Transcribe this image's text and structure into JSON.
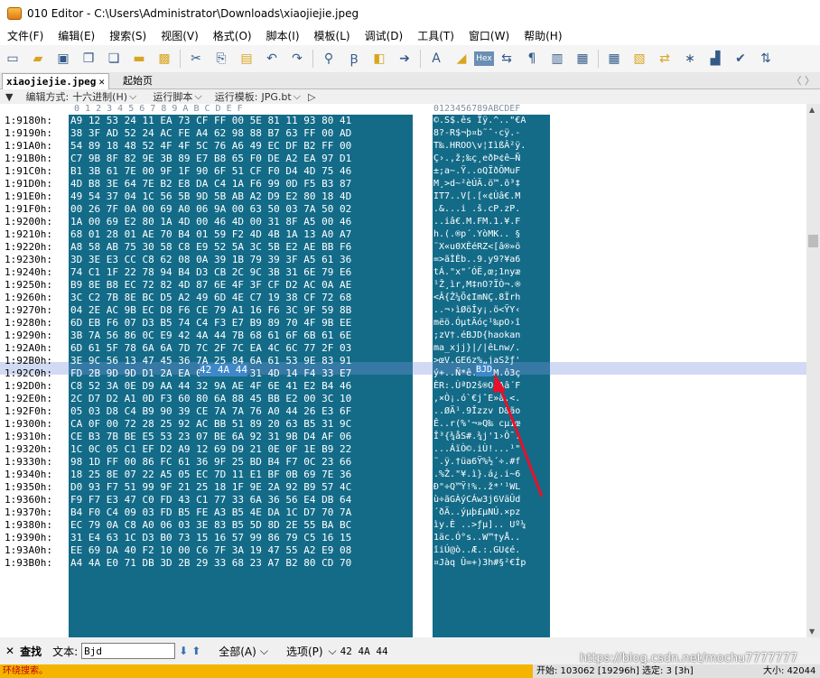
{
  "window": {
    "title": "010 Editor - C:\\Users\\Administrator\\Downloads\\xiaojiejie.jpeg"
  },
  "menu": [
    "文件(F)",
    "编辑(E)",
    "搜索(S)",
    "视图(V)",
    "格式(O)",
    "脚本(I)",
    "模板(L)",
    "调试(D)",
    "工具(T)",
    "窗口(W)",
    "帮助(H)"
  ],
  "toolbar": {
    "hex_label": "Hex"
  },
  "tabs": {
    "active": "xiaojiejie.jpeg",
    "close": "✕",
    "second": "起始页",
    "nav": "〈 〉"
  },
  "options": {
    "edit_mode_label": "编辑方式:",
    "edit_mode_value": "十六进制(H)",
    "run_script": "运行脚本",
    "run_template_label": "运行模板:",
    "run_template_value": "JPG.bt"
  },
  "columns": {
    "hex": "0  1  2  3  4  5  6  7  8  9  A  B  C  D  E  F",
    "ascii": "0123456789ABCDEF"
  },
  "rows": [
    {
      "addr": "1:9180h:",
      "hex": "A9 12 53 24 11 EA 73 CF FF 00 5E 81 11 93 80 41",
      "ascii": "©.S$.ês Ïÿ.^..\"€A"
    },
    {
      "addr": "1:9190h:",
      "hex": "38 3F AD 52 24 AC FE A4 62 98 88 B7 63 FF 00 AD",
      "ascii": "8?-R$¬þ¤b˜ˆ·cÿ.-"
    },
    {
      "addr": "1:91A0h:",
      "hex": "54 89 18 48 52 4F 4F 5C 76 A6 49 EC DF B2 FF 00",
      "ascii": "T‰.HROO\\v¦IìßÂ²ÿ."
    },
    {
      "addr": "1:91B0h:",
      "hex": "C7 9B 8F 82 9E 3B 89 E7 B8 65 F0 DE A2 EA 97 D1",
      "ascii": "Ç›.‚ž;‰ç¸eðÞ¢ê—Ñ"
    },
    {
      "addr": "1:91C0h:",
      "hex": "B1 3B 61 7E 00 9F 1F 90 6F 51 CF F0 D4 4D 75 46",
      "ascii": "±;a~.Ÿ..oQÏðÔMuF"
    },
    {
      "addr": "1:91D0h:",
      "hex": "4D B8 3E 64 7E B2 E8 DA C4 1A F6 99 0D F5 B3 87",
      "ascii": "M¸>d~²èÚÄ.ö™.õ³‡"
    },
    {
      "addr": "1:91E0h:",
      "hex": "49 54 37 04 1C 56 5B 9D 5B AB A2 D9 E2 80 18 4D",
      "ascii": "IT7..V[.[«¢Ùâ€.M"
    },
    {
      "addr": "1:91F0h:",
      "hex": "00 26 7F 0A 00 69 A0 06 9A 00 63 50 03 7A 50 02",
      "ascii": ".&...i .š.cP.zP."
    },
    {
      "addr": "1:9200h:",
      "hex": "1A 00 69 E2 80 1A 4D 00 46 4D 00 31 8F A5 00 46",
      "ascii": "..iâ€.M.FM.1.¥.F"
    },
    {
      "addr": "1:9210h:",
      "hex": "68 01 28 01 AE 70 B4 01 59 F2 4D 4B 1A 13 A0 A7",
      "ascii": "h.(.®p´.YòMK.. §"
    },
    {
      "addr": "1:9220h:",
      "hex": "A8 58 AB 75 30 58 C8 E9 52 5A 3C 5B E2 AE BB F6",
      "ascii": "¨X«u0XÈéRZ<[â®»ö"
    },
    {
      "addr": "1:9230h:",
      "hex": "3D 3E E3 CC C8 62 08 0A 39 1B 79 39 3F A5 61 36",
      "ascii": "=>ãÌÈb..9.y9?¥a6"
    },
    {
      "addr": "1:9240h:",
      "hex": "74 C1 1F 22 78 94 B4 D3 CB 2C 9C 3B 31 6E 79 E6",
      "ascii": "tÁ.\"x\"´ÓË,œ;1nyæ"
    },
    {
      "addr": "1:9250h:",
      "hex": "B9 8E B8 EC 72 82 4D 87 6E 4F 3F CF D2 AC 0A AE",
      "ascii": "¹Ž¸ìr‚M‡nO?ÏÒ¬.®"
    },
    {
      "addr": "1:9260h:",
      "hex": "3C C2 7B 8E BC D5 A2 49 6D 4E C7 19 38 CF 72 68",
      "ascii": "<Â{Ž¼Õ¢ImNÇ.8Ïrh"
    },
    {
      "addr": "1:9270h:",
      "hex": "04 2E AC 9B EC D8 F6 CE 79 A1 16 F6 3C 9F 59 8B",
      "ascii": "..¬›ìØöÎy¡.ö<ŸY‹"
    },
    {
      "addr": "1:9280h:",
      "hex": "6D EB F6 07 D3 B5 74 C4 F3 E7 B9 89 70 4F 9B EE",
      "ascii": "mëö.ÓµtÄóç¹‰pO›î"
    },
    {
      "addr": "1:9290h:",
      "hex": "3B 7A 56 86 0C E9 42 4A 44 7B 68 61 6F 6B 61 6E",
      "ascii": ";zV†.éBJD{haokan"
    },
    {
      "addr": "1:92A0h:",
      "hex": "6D 61 5F 78 6A 6A 7D 7C 2F 7C EA 4C 6C 77 2F 03",
      "ascii": "ma_xjj}|/|êLnw/."
    },
    {
      "addr": "1:92B0h:",
      "hex": "3E 9C 56 13 47 45 36 7A 25 84 6A 61 53 9E 83 91",
      "ascii": ">œV.GE6z%„jaSžƒ'"
    },
    {
      "addr": "1:92C0h:",
      "hex": "FD 2B 9D 9D D1 2A EA 0B 89 30 31 4D 14 F4 33 E7",
      "ascii": "ý+..Ñ*ê.‰01M.ô3ç"
    },
    {
      "addr": "1:92D0h:",
      "hex": "C8 52 3A 0E D9 AA 44 32 9A AE 4F 6E 41 E2 B4 46",
      "ascii": "ÈR:.ÙªD2š®OnAâ´F"
    },
    {
      "addr": "1:92E0h:",
      "hex": "2C D7 D2 A1 0D F3 60 80 6A 88 45 BB E2 00 3C 10",
      "ascii": ",×Ò¡.ó`€jˆE»â.<."
    },
    {
      "addr": "1:92F0h:",
      "hex": "05 03 D8 C4 B9 90 39 CE 7A 7A 76 A0 44 26 E3 6F",
      "ascii": "..ØÄ¹.9Îzzv D&ão"
    },
    {
      "addr": "1:9300h:",
      "hex": "CA 0F 00 72 28 25 92 AC BB 51 89 20 63 B5 31 9C",
      "ascii": "Ê..r(%'¬»Q‰ cµ1œ"
    },
    {
      "addr": "1:9310h:",
      "hex": "CE B3 7B BE E5 53 23 07 BE 6A 92 31 9B D4 AF 06",
      "ascii": "Î³{¾åS#.¾j'1›Ô¯."
    },
    {
      "addr": "1:9320h:",
      "hex": "1C 0C 05 C1 EF D2 A9 12 69 D9 21 0E 0F 1E B9 22",
      "ascii": "...ÁïÒ©.iÙ!...¹\""
    },
    {
      "addr": "1:9330h:",
      "hex": "98 1D FF 00 86 FC 61 36 9F 25 BD B4 F7 0C 23 66",
      "ascii": "˜.ÿ.†üa6Ÿ%½´÷.#f"
    },
    {
      "addr": "1:9340h:",
      "hex": "18 25 8E 07 22 A5 05 EC 7D 11 E1 BF 0B 69 7E 36",
      "ascii": ".%Ž.\"¥.ì}.á¿.i~6"
    },
    {
      "addr": "1:9350h:",
      "hex": "D0 93 F7 51 99 9F 21 25 18 1F 9E 2A 92 B9 57 4C",
      "ascii": "Ð\"÷Q™Ÿ!%..ž*'¹WL"
    },
    {
      "addr": "1:9360h:",
      "hex": "F9 F7 E3 47 C0 FD 43 C1 77 33 6A 36 56 E4 DB 64",
      "ascii": "ù÷ãGÀýCÁw3j6VäÛd"
    },
    {
      "addr": "1:9370h:",
      "hex": "B4 F0 C4 09 03 FD B5 FE A3 B5 4E DA 1C D7 70 7A",
      "ascii": "´ðÄ..ýµþ£µNÚ.×pz"
    },
    {
      "addr": "1:9380h:",
      "hex": "EC 79 0A C8 A0 06 03 3E 83 B5 5D 8D 2E 55 BA BC",
      "ascii": "ìy.È ..>ƒµ].. Uº¼"
    },
    {
      "addr": "1:9390h:",
      "hex": "31 E4 63 1C D3 B0 73 15 16 57 99 86 79 C5 16 15",
      "ascii": "1äc.Ó°s..W™†yÅ.."
    },
    {
      "addr": "1:93A0h:",
      "hex": "EE 69 DA 40 F2 10 00 C6 7F 3A 19 47 55 A2 E9 08",
      "ascii": "îiÚ@ò..Æ.:.GU¢é."
    },
    {
      "addr": "1:93B0h:",
      "hex": "A4 4A E0 71 DB 3D 2B 29 33 68 23 A7 B2 80 CD 70",
      "ascii": "¤Jàq Û=+)3h#§²€Íp"
    }
  ],
  "selection": {
    "hex": "42 4A 44",
    "ascii": "BJD"
  },
  "find": {
    "label": "查找",
    "text_label": "文本:",
    "value": "Bjd",
    "all": "全部(A)",
    "options": "选项(P)",
    "result": "42 4A 44"
  },
  "status": {
    "message": "环绕搜索。",
    "position": "开始: 103062 [19296h]",
    "selection": "选定: 3 [3h]",
    "size": "大小: 42044"
  },
  "watermark": "https://blog.csdn.net/mochu7777777",
  "colors": {
    "hex_bg": "#136b88",
    "highlight": "#3f88c8",
    "arrow": "#e8102a",
    "status_bg": "#f4b400"
  }
}
